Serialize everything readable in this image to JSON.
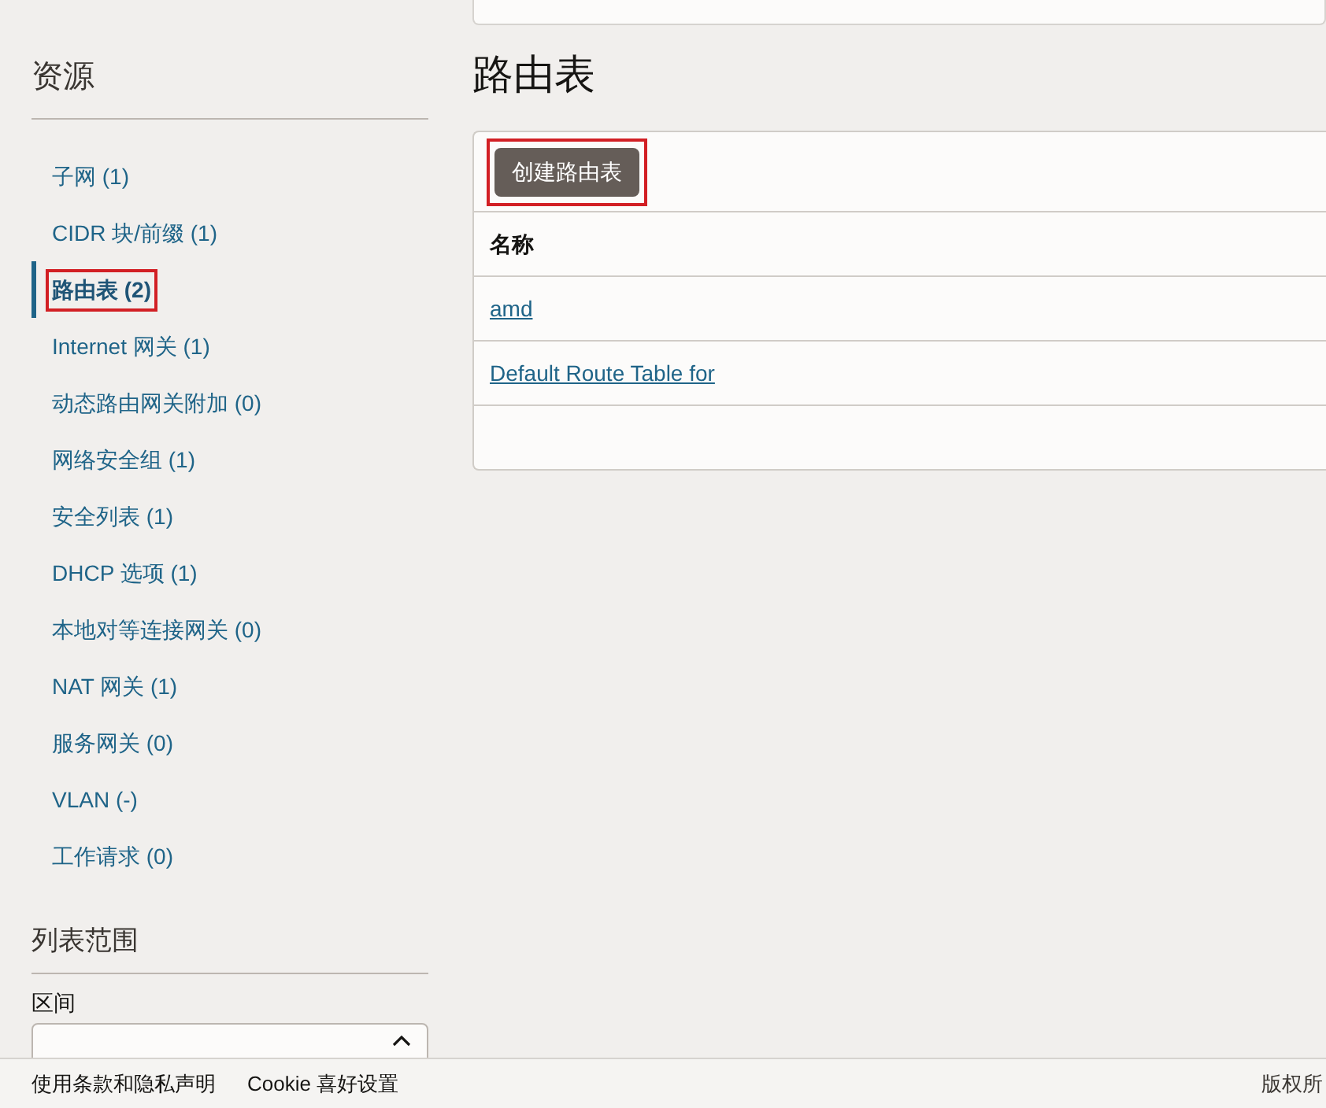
{
  "sidebar": {
    "title": "资源",
    "items": [
      {
        "label": "子网 (1)",
        "selected": false,
        "highlighted": false
      },
      {
        "label": "CIDR 块/前缀 (1)",
        "selected": false,
        "highlighted": false
      },
      {
        "label": "路由表 (2)",
        "selected": true,
        "highlighted": true
      },
      {
        "label": "Internet 网关 (1)",
        "selected": false,
        "highlighted": false
      },
      {
        "label": "动态路由网关附加 (0)",
        "selected": false,
        "highlighted": false
      },
      {
        "label": "网络安全组 (1)",
        "selected": false,
        "highlighted": false
      },
      {
        "label": "安全列表 (1)",
        "selected": false,
        "highlighted": false
      },
      {
        "label": "DHCP 选项 (1)",
        "selected": false,
        "highlighted": false
      },
      {
        "label": "本地对等连接网关 (0)",
        "selected": false,
        "highlighted": false
      },
      {
        "label": "NAT 网关 (1)",
        "selected": false,
        "highlighted": false
      },
      {
        "label": "服务网关 (0)",
        "selected": false,
        "highlighted": false
      },
      {
        "label": "VLAN (-)",
        "selected": false,
        "highlighted": false
      },
      {
        "label": "工作请求 (0)",
        "selected": false,
        "highlighted": false
      }
    ],
    "scope_title": "列表范围",
    "compartment_label": "区间"
  },
  "main": {
    "title": "路由表",
    "create_button": {
      "label": "创建路由表",
      "highlighted": true
    },
    "table": {
      "columns": [
        "名称"
      ],
      "rows": [
        [
          "amd"
        ],
        [
          "Default Route Table for"
        ]
      ]
    }
  },
  "footer": {
    "links": [
      "使用条款和隐私声明",
      "Cookie 喜好设置"
    ],
    "copyright": "版权所"
  }
}
